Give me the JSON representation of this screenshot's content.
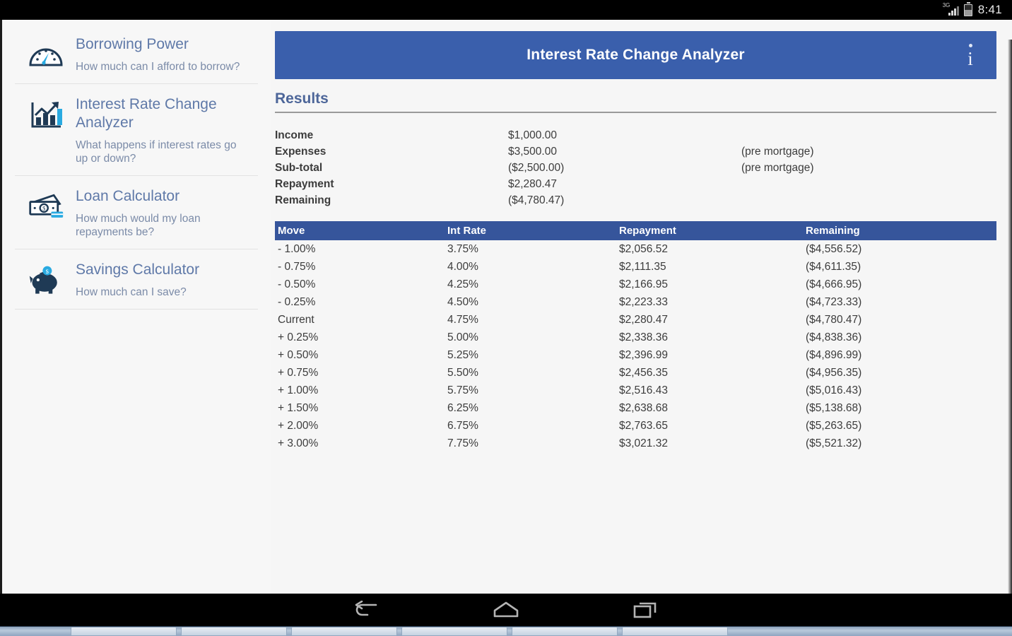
{
  "status_bar": {
    "network_label": "3G",
    "signal_icon": "signal-bars-icon",
    "battery_icon": "battery-icon",
    "time": "8:41"
  },
  "sidebar": {
    "items": [
      {
        "icon": "speedometer-icon",
        "title": "Borrowing Power",
        "subtitle": "How much can I afford to borrow?"
      },
      {
        "icon": "bar-chart-growth-icon",
        "title": "Interest Rate Change Analyzer",
        "subtitle": "What happens if interest rates go up or down?"
      },
      {
        "icon": "banknotes-icon",
        "title": "Loan Calculator",
        "subtitle": "How much would my loan repayments be?"
      },
      {
        "icon": "piggy-bank-icon",
        "title": "Savings Calculator",
        "subtitle": "How much can I save?"
      }
    ]
  },
  "header": {
    "title": "Interest Rate Change Analyzer",
    "info_icon": "info-icon",
    "accent_color": "#3a5fac"
  },
  "results": {
    "section_title": "Results",
    "summary": [
      {
        "label": "Income",
        "value": "$1,000.00",
        "note": ""
      },
      {
        "label": "Expenses",
        "value": "$3,500.00",
        "note": "(pre mortgage)"
      },
      {
        "label": "Sub-total",
        "value": "($2,500.00)",
        "note": "(pre mortgage)"
      },
      {
        "label": "Repayment",
        "value": "$2,280.47",
        "note": ""
      },
      {
        "label": "Remaining",
        "value": "($4,780.47)",
        "note": ""
      }
    ],
    "table": {
      "header_color": "#36559b",
      "columns": [
        "Move",
        "Int Rate",
        "Repayment",
        "Remaining"
      ],
      "rows": [
        [
          "- 1.00%",
          "3.75%",
          "$2,056.52",
          "($4,556.52)"
        ],
        [
          "- 0.75%",
          "4.00%",
          "$2,111.35",
          "($4,611.35)"
        ],
        [
          "- 0.50%",
          "4.25%",
          "$2,166.95",
          "($4,666.95)"
        ],
        [
          "- 0.25%",
          "4.50%",
          "$2,223.33",
          "($4,723.33)"
        ],
        [
          "Current",
          "4.75%",
          "$2,280.47",
          "($4,780.47)"
        ],
        [
          "+ 0.25%",
          "5.00%",
          "$2,338.36",
          "($4,838.36)"
        ],
        [
          "+ 0.50%",
          "5.25%",
          "$2,396.99",
          "($4,896.99)"
        ],
        [
          "+ 0.75%",
          "5.50%",
          "$2,456.35",
          "($4,956.35)"
        ],
        [
          "+ 1.00%",
          "5.75%",
          "$2,516.43",
          "($5,016.43)"
        ],
        [
          "+ 1.50%",
          "6.25%",
          "$2,638.68",
          "($5,138.68)"
        ],
        [
          "+ 2.00%",
          "6.75%",
          "$2,763.65",
          "($5,263.65)"
        ],
        [
          "+ 3.00%",
          "7.75%",
          "$3,021.32",
          "($5,521.32)"
        ]
      ]
    }
  },
  "android_nav": {
    "back_icon": "back-arrow-icon",
    "home_icon": "home-icon",
    "recents_icon": "recent-apps-icon"
  }
}
